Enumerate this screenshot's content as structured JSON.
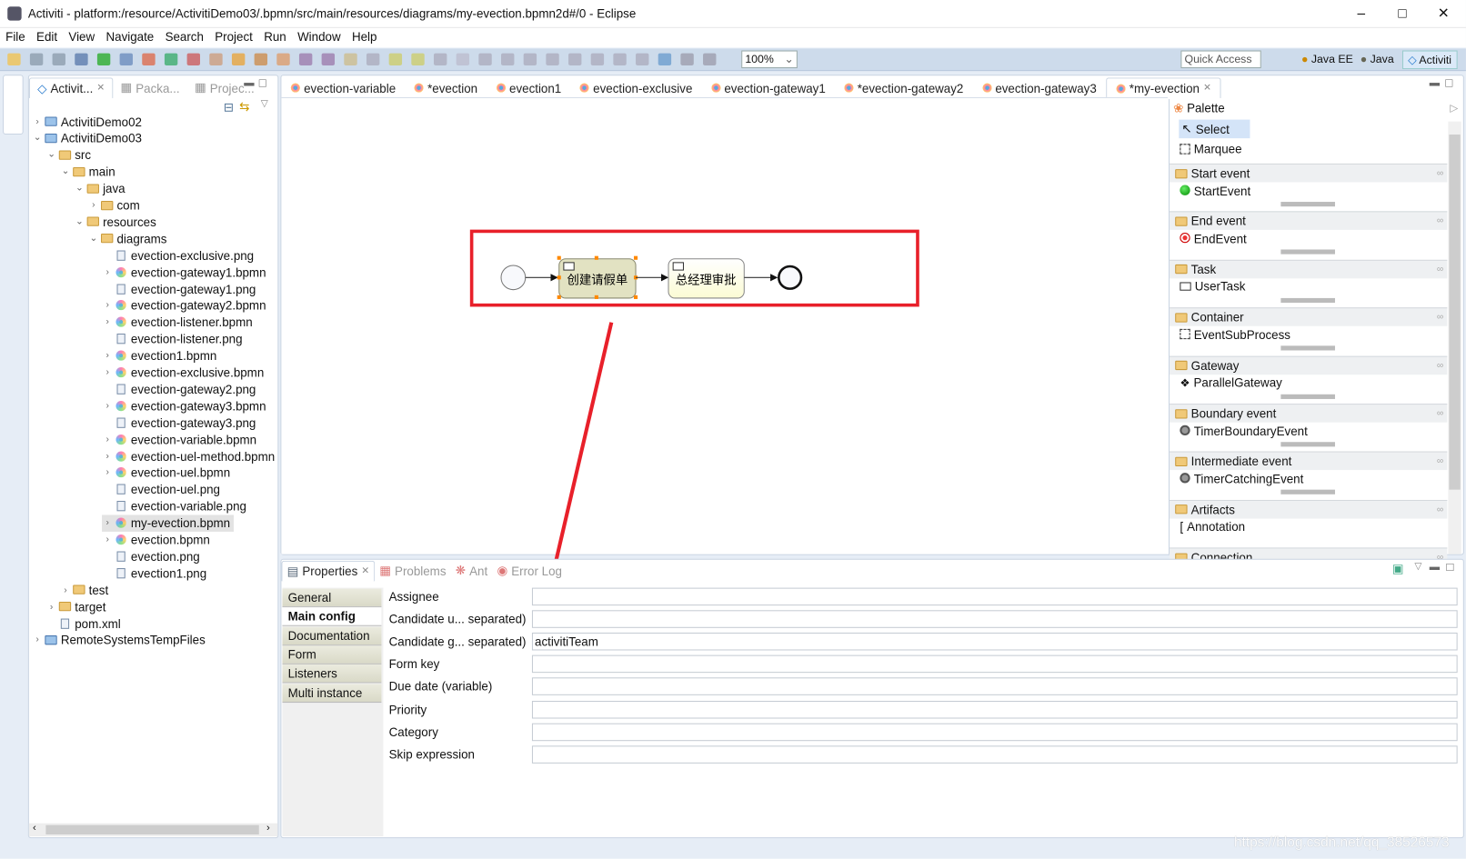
{
  "window": {
    "title": "Activiti - platform:/resource/ActivitiDemo03/.bpmn/src/main/resources/diagrams/my-evection.bpmn2d#/0 - Eclipse",
    "controls": [
      "minimize",
      "maximize",
      "close"
    ]
  },
  "menu": [
    "File",
    "Edit",
    "View",
    "Navigate",
    "Search",
    "Project",
    "Run",
    "Window",
    "Help"
  ],
  "toolbar": {
    "zoom": "100%",
    "quick_access": "Quick Access",
    "perspectives": [
      "Java EE",
      "Java",
      "Activiti"
    ],
    "active_perspective": "Activiti"
  },
  "explorer": {
    "tabs": [
      "Activit...",
      "Packa...",
      "Projec..."
    ],
    "tree": [
      {
        "label": "ActivitiDemo02",
        "level": 0,
        "type": "project",
        "expanded": false
      },
      {
        "label": "ActivitiDemo03",
        "level": 0,
        "type": "project",
        "expanded": true
      },
      {
        "label": "src",
        "level": 1,
        "type": "folder",
        "expanded": true
      },
      {
        "label": "main",
        "level": 2,
        "type": "folder",
        "expanded": true
      },
      {
        "label": "java",
        "level": 3,
        "type": "folder",
        "expanded": true
      },
      {
        "label": "com",
        "level": 4,
        "type": "folder",
        "expanded": false
      },
      {
        "label": "resources",
        "level": 3,
        "type": "folder",
        "expanded": true
      },
      {
        "label": "diagrams",
        "level": 4,
        "type": "folder",
        "expanded": true
      },
      {
        "label": "evection-exclusive.png",
        "level": 5,
        "type": "file"
      },
      {
        "label": "evection-gateway1.bpmn",
        "level": 5,
        "type": "bpmn"
      },
      {
        "label": "evection-gateway1.png",
        "level": 5,
        "type": "file"
      },
      {
        "label": "evection-gateway2.bpmn",
        "level": 5,
        "type": "bpmn"
      },
      {
        "label": "evection-listener.bpmn",
        "level": 5,
        "type": "bpmn"
      },
      {
        "label": "evection-listener.png",
        "level": 5,
        "type": "file"
      },
      {
        "label": "evection1.bpmn",
        "level": 5,
        "type": "bpmn"
      },
      {
        "label": "evection-exclusive.bpmn",
        "level": 5,
        "type": "bpmn"
      },
      {
        "label": "evection-gateway2.png",
        "level": 5,
        "type": "file"
      },
      {
        "label": "evection-gateway3.bpmn",
        "level": 5,
        "type": "bpmn"
      },
      {
        "label": "evection-gateway3.png",
        "level": 5,
        "type": "file"
      },
      {
        "label": "evection-variable.bpmn",
        "level": 5,
        "type": "bpmn"
      },
      {
        "label": "evection-uel-method.bpmn",
        "level": 5,
        "type": "bpmn"
      },
      {
        "label": "evection-uel.bpmn",
        "level": 5,
        "type": "bpmn"
      },
      {
        "label": "evection-uel.png",
        "level": 5,
        "type": "file"
      },
      {
        "label": "evection-variable.png",
        "level": 5,
        "type": "file"
      },
      {
        "label": "my-evection.bpmn",
        "level": 5,
        "type": "bpmn",
        "selected": true
      },
      {
        "label": "evection.bpmn",
        "level": 5,
        "type": "bpmn"
      },
      {
        "label": "evection.png",
        "level": 5,
        "type": "file"
      },
      {
        "label": "evection1.png",
        "level": 5,
        "type": "file"
      },
      {
        "label": "test",
        "level": 2,
        "type": "folder",
        "expanded": false
      },
      {
        "label": "target",
        "level": 1,
        "type": "folder",
        "expanded": false
      },
      {
        "label": "pom.xml",
        "level": 1,
        "type": "xml"
      },
      {
        "label": "RemoteSystemsTempFiles",
        "level": 0,
        "type": "project",
        "expanded": false
      }
    ]
  },
  "editor": {
    "tabs": [
      "evection-variable",
      "*evection",
      "evection1",
      "evection-exclusive",
      "evection-gateway1",
      "*evection-gateway2",
      "evection-gateway3",
      "*my-evection"
    ],
    "active_tab": "*my-evection",
    "diagram": {
      "task1": "创建请假单",
      "task2": "总经理审批",
      "selected": "task1"
    }
  },
  "palette": {
    "title": "Palette",
    "tools": [
      "Select",
      "Marquee"
    ],
    "groups": [
      {
        "name": "Start event",
        "item": "StartEvent",
        "icon": "green-circle"
      },
      {
        "name": "End event",
        "item": "EndEvent",
        "icon": "red-circle"
      },
      {
        "name": "Task",
        "item": "UserTask",
        "icon": "user-task"
      },
      {
        "name": "Container",
        "item": "EventSubProcess",
        "icon": "dashed-box"
      },
      {
        "name": "Gateway",
        "item": "ParallelGateway",
        "icon": "diamond-plus"
      },
      {
        "name": "Boundary event",
        "item": "TimerBoundaryEvent",
        "icon": "timer"
      },
      {
        "name": "Intermediate event",
        "item": "TimerCatchingEvent",
        "icon": "timer"
      },
      {
        "name": "Artifacts",
        "item": "Annotation",
        "icon": "bracket"
      },
      {
        "name": "Connection"
      }
    ]
  },
  "properties": {
    "tabs": [
      "Properties",
      "Problems",
      "Ant",
      "Error Log"
    ],
    "sections": [
      "General",
      "Main config",
      "Documentation",
      "Form",
      "Listeners",
      "Multi instance"
    ],
    "active_section": "Main config",
    "fields": [
      {
        "label": "Assignee",
        "value": ""
      },
      {
        "label": "Candidate u... separated)",
        "value": ""
      },
      {
        "label": "Candidate g... separated)",
        "value": "activitiTeam"
      },
      {
        "label": "Form key",
        "value": ""
      },
      {
        "label": "Due date (variable)",
        "value": ""
      },
      {
        "label": "Priority",
        "value": ""
      },
      {
        "label": "Category",
        "value": ""
      },
      {
        "label": "Skip expression",
        "value": ""
      }
    ]
  },
  "watermark": "https://blog.csdn.net/qq_38526573",
  "colors": {
    "annotation": "#e8202a",
    "selected_task": "#e2e2c2",
    "task": "#fefee6",
    "toolbar": "#cddbeb"
  }
}
